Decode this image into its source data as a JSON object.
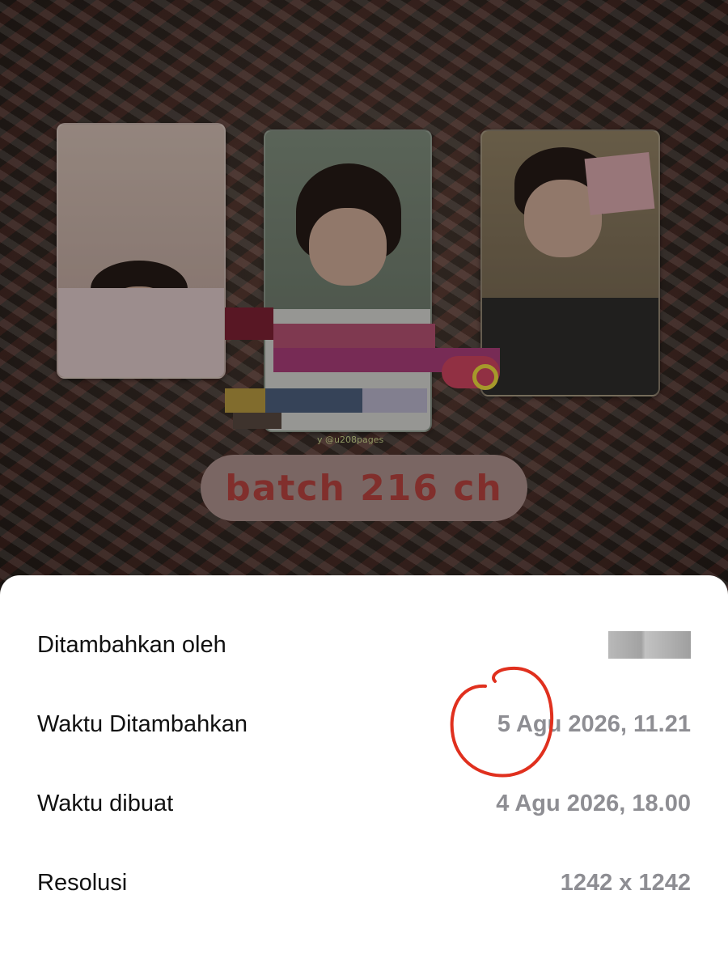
{
  "photo": {
    "badge_text": "batch 216 ch",
    "credit_text": "y @u208pages"
  },
  "info": {
    "rows": [
      {
        "label": "Ditambahkan oleh",
        "value": ""
      },
      {
        "label": "Waktu Ditambahkan",
        "value": "5 Agu 2026, 11.21"
      },
      {
        "label": "Waktu dibuat",
        "value": "4 Agu 2026, 18.00"
      },
      {
        "label": "Resolusi",
        "value": "1242 x 1242"
      }
    ]
  },
  "colors": {
    "annotation_circle": "#e0301e",
    "badge_text": "#b3423e",
    "value_text": "#8e8e93"
  }
}
